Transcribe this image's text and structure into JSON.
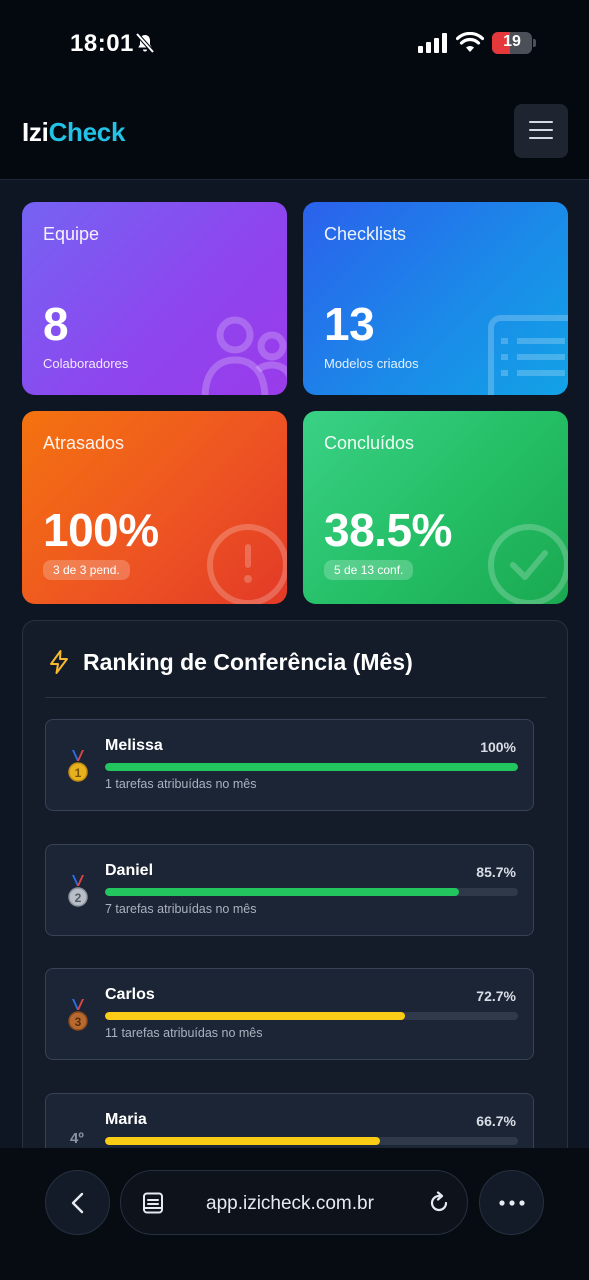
{
  "status_bar": {
    "time": "18:01",
    "battery_level": "19",
    "icons": [
      "bell-off-icon",
      "signal-icon",
      "wifi-icon",
      "battery-icon"
    ]
  },
  "app": {
    "logo_part1": "Izi",
    "logo_part2": "Check",
    "menu_icon": "hamburger-menu-icon"
  },
  "stats": {
    "equipe": {
      "label": "Equipe",
      "value": "8",
      "sub": "Colaboradores",
      "icon": "users-icon",
      "color": "#8b4cef"
    },
    "checklists": {
      "label": "Checklists",
      "value": "13",
      "sub": "Modelos criados",
      "icon": "list-icon",
      "color": "#1f7ee9"
    },
    "atrasados": {
      "label": "Atrasados",
      "value": "100%",
      "sub": "3 de 3 pend.",
      "icon": "alert-circle-icon",
      "color": "#ee5522"
    },
    "concluidos": {
      "label": "Concluídos",
      "value": "38.5%",
      "sub": "5 de 13 conf.",
      "icon": "check-circle-icon",
      "color": "#24be65"
    }
  },
  "ranking": {
    "title": "Ranking de Conferência (Mês)",
    "icon": "lightning-icon",
    "items": [
      {
        "position": "1",
        "medal": "gold-medal-icon",
        "name": "Melissa",
        "percent": "100%",
        "progress": 1.0,
        "color": "#22c55e",
        "sub": "1 tarefas atribuídas no mês"
      },
      {
        "position": "2",
        "medal": "silver-medal-icon",
        "name": "Daniel",
        "percent": "85.7%",
        "progress": 0.857,
        "color": "#22c55e",
        "sub": "7 tarefas atribuídas no mês"
      },
      {
        "position": "3",
        "medal": "bronze-medal-icon",
        "name": "Carlos",
        "percent": "72.7%",
        "progress": 0.727,
        "color": "#facc15",
        "sub": "11 tarefas atribuídas no mês"
      },
      {
        "position": "4º",
        "medal": "",
        "name": "Maria",
        "percent": "66.7%",
        "progress": 0.667,
        "color": "#facc15",
        "sub": ""
      }
    ]
  },
  "browser": {
    "url": "app.izicheck.com.br",
    "back_icon": "chevron-left-icon",
    "tabs_icon": "page-icon",
    "reload_icon": "reload-icon",
    "more_icon": "more-dots-icon"
  },
  "colors": {
    "background": "#0f1623",
    "accent": "#22c3e6"
  }
}
